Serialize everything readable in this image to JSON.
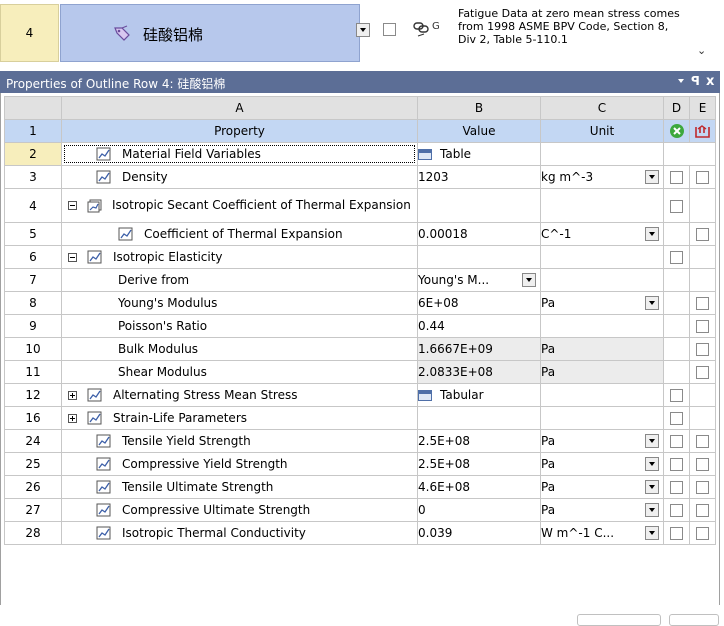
{
  "outline_row": {
    "row_number": "4",
    "material_name": "硅酸铝棉",
    "link_label": "G",
    "description": "Fatigue Data at zero mean stress comes from 1998 ASME BPV Code, Section 8, Div 2, Table 5-110.1"
  },
  "panel": {
    "title": "Properties of Outline Row 4: 硅酸铝棉",
    "pin_label": "ꟼ",
    "close_label": "x"
  },
  "columns": {
    "letters": [
      "A",
      "B",
      "C",
      "D",
      "E"
    ],
    "property": "Property",
    "value": "Value",
    "unit": "Unit"
  },
  "rows": [
    {
      "num": "1"
    },
    {
      "num": "2",
      "property": "Material Field Variables",
      "value": "Table"
    },
    {
      "num": "3",
      "property": "Density",
      "value": "1203",
      "unit": "kg m^-3"
    },
    {
      "num": "4",
      "property": "Isotropic Secant Coefficient of Thermal Expansion"
    },
    {
      "num": "5",
      "property": "Coefficient of Thermal Expansion",
      "value": "0.00018",
      "unit": "C^-1"
    },
    {
      "num": "6",
      "property": "Isotropic Elasticity"
    },
    {
      "num": "7",
      "property": "Derive from",
      "value": "Young's M..."
    },
    {
      "num": "8",
      "property": "Young's Modulus",
      "value": "6E+08",
      "unit": "Pa"
    },
    {
      "num": "9",
      "property": "Poisson's Ratio",
      "value": "0.44"
    },
    {
      "num": "10",
      "property": "Bulk Modulus",
      "value": "1.6667E+09",
      "unit": "Pa"
    },
    {
      "num": "11",
      "property": "Shear Modulus",
      "value": "2.0833E+08",
      "unit": "Pa"
    },
    {
      "num": "12",
      "property": "Alternating Stress Mean Stress",
      "value": "Tabular"
    },
    {
      "num": "16",
      "property": "Strain-Life Parameters"
    },
    {
      "num": "24",
      "property": "Tensile Yield Strength",
      "value": "2.5E+08",
      "unit": "Pa"
    },
    {
      "num": "25",
      "property": "Compressive Yield Strength",
      "value": "2.5E+08",
      "unit": "Pa"
    },
    {
      "num": "26",
      "property": "Tensile Ultimate Strength",
      "value": "4.6E+08",
      "unit": "Pa"
    },
    {
      "num": "27",
      "property": "Compressive Ultimate Strength",
      "value": "0",
      "unit": "Pa"
    },
    {
      "num": "28",
      "property": "Isotropic Thermal Conductivity",
      "value": "0.039",
      "unit": "W m^-1 C..."
    }
  ],
  "icons": {
    "material": "material-tag-icon",
    "property": "property-chart-icon",
    "table": "table-icon",
    "link": "link-icon",
    "suppress": "suppress-icon",
    "parameter": "parameter-icon"
  },
  "colors": {
    "panel_header": "#5c6e96",
    "selected_row": "#f7eebc",
    "property_header": "#c3d7f3",
    "outline_name_cell": "#b7c8ec"
  }
}
